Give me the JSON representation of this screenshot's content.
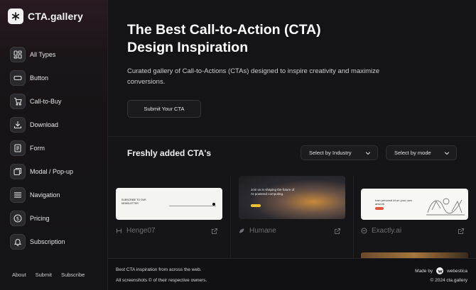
{
  "brand": {
    "name": "CTA.gallery",
    "icon": "asterisk-logo-icon"
  },
  "sidebar": {
    "items": [
      {
        "label": "All Types",
        "icon": "grid-icon"
      },
      {
        "label": "Button",
        "icon": "button-icon"
      },
      {
        "label": "Call-to-Buy",
        "icon": "cart-icon"
      },
      {
        "label": "Download",
        "icon": "download-icon"
      },
      {
        "label": "Form",
        "icon": "form-icon"
      },
      {
        "label": "Modal / Pop-up",
        "icon": "modal-icon"
      },
      {
        "label": "Navigation",
        "icon": "menu-icon"
      },
      {
        "label": "Pricing",
        "icon": "dollar-icon"
      },
      {
        "label": "Subscription",
        "icon": "bell-icon"
      }
    ],
    "footer": {
      "about": "About",
      "submit": "Submit",
      "subscribe": "Subscribe"
    }
  },
  "hero": {
    "title_line1": "The Best Call-to-Action (CTA)",
    "title_line2": "Design Inspiration",
    "description": "Curated gallery of Call-to-Actions (CTAs) designed to inspire creativity and maximize conversions.",
    "button": "Submit Your CTA"
  },
  "section": {
    "title": "Freshly added CTA's",
    "industry_select": "Select by Industry",
    "mode_select": "Select by mode"
  },
  "cards": [
    {
      "name": "Henge07",
      "thumb_text": "SUBSCRIBE TO OUR NEWSLETTER"
    },
    {
      "name": "Humane",
      "thumb_text": "Join us in shaping the future of AI-powered computing."
    },
    {
      "name": "Exactly.ai",
      "thumb_text": "train personal AI on your own artwork"
    }
  ],
  "footer": {
    "line1": "Best CTA inspiration from across the web.",
    "line2": "All screenshots © of their respective owners.",
    "made_by": "Made by",
    "maker": "webestica",
    "copyright": "© 2024 cta.gallery"
  },
  "colors": {
    "background": "#121214",
    "sidebar_top": "#2a1a22",
    "accent_yellow": "#f2c230",
    "accent_red": "#e2553b"
  }
}
